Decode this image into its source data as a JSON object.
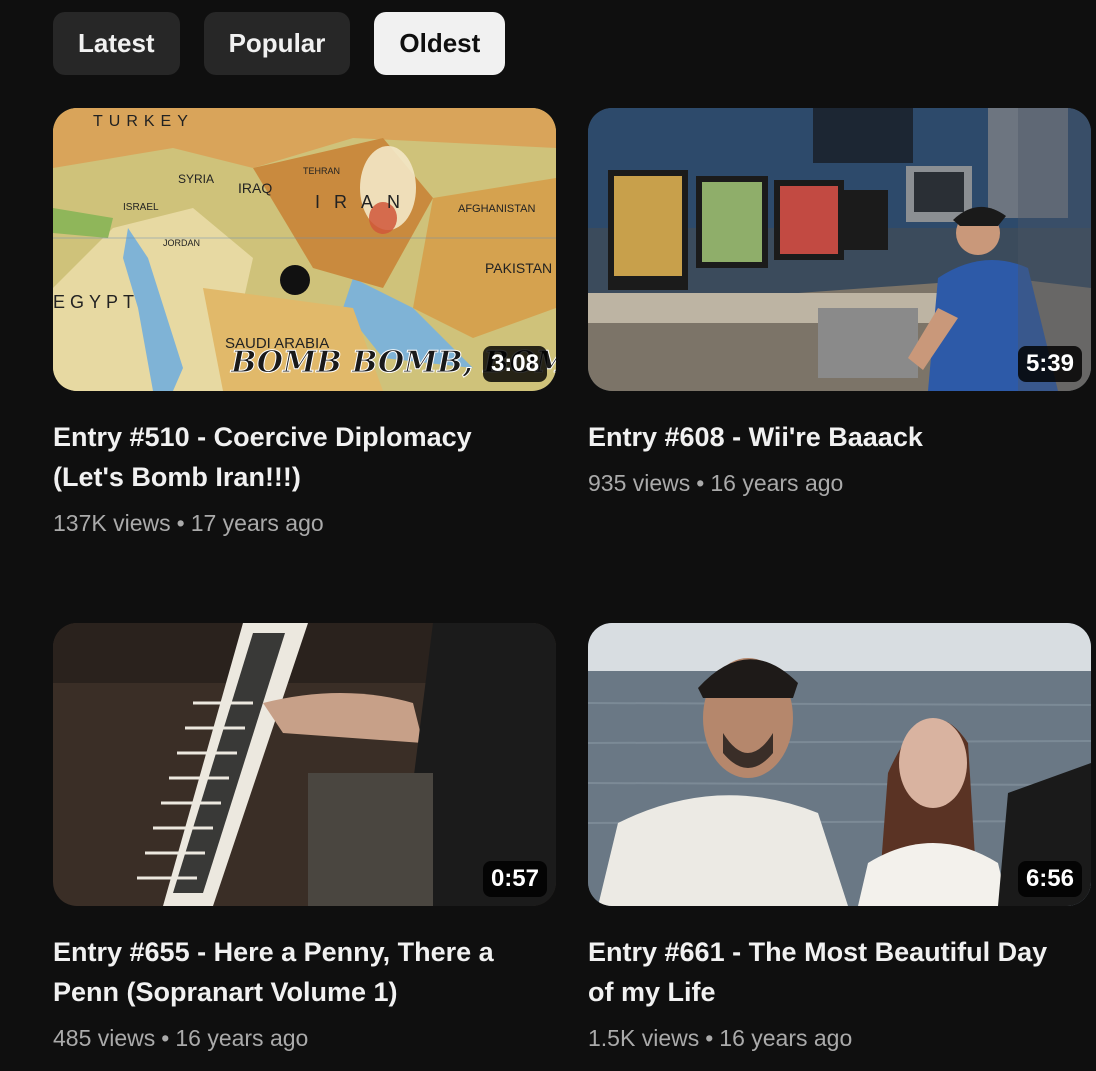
{
  "filters": [
    {
      "label": "Latest",
      "active": false
    },
    {
      "label": "Popular",
      "active": false
    },
    {
      "label": "Oldest",
      "active": true
    }
  ],
  "videos": [
    {
      "title": "Entry #510 - Coercive Diplomacy (Let's Bomb Iran!!!)",
      "duration": "3:08",
      "views": "137K views",
      "age": "17 years ago",
      "thumb_labels": [
        "TURKEY",
        "SYRIA",
        "IRAQ",
        "TEHRAN",
        "IRAN",
        "AFGHANISTAN",
        "PAKISTAN",
        "EGYPT",
        "ISRAEL",
        "JORDAN",
        "SAUDI ARABIA",
        "BOMB BOMB, BOMB"
      ]
    },
    {
      "title": "Entry #608 - Wii're Baaack",
      "duration": "5:39",
      "views": "935 views",
      "age": "16 years ago"
    },
    {
      "title": "Entry #655 - Here a Penny, There a Penn (Sopranart Volume 1)",
      "duration": "0:57",
      "views": "485 views",
      "age": "16 years ago"
    },
    {
      "title": "Entry #661 - The Most Beautiful Day of my Life",
      "duration": "6:56",
      "views": "1.5K views",
      "age": "16 years ago"
    }
  ]
}
